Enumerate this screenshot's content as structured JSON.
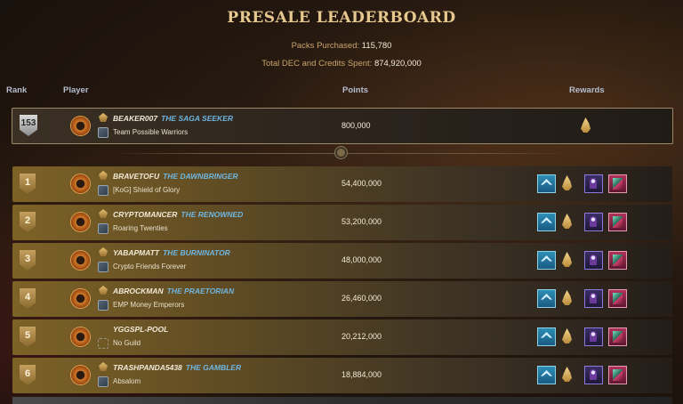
{
  "title": "PRESALE LEADERBOARD",
  "stats": {
    "packs_label": "Packs Purchased:",
    "packs_value": "115,780",
    "spent_label": "Total DEC and Credits Spent:",
    "spent_value": "874,920,000"
  },
  "headers": {
    "rank": "Rank",
    "player": "Player",
    "points": "Points",
    "rewards": "Rewards"
  },
  "current_player": {
    "rank": "153",
    "name": "BEAKER007",
    "title": "THE SAGA SEEKER",
    "guild": "Team Possible Warriors",
    "points": "800,000"
  },
  "rows": [
    {
      "rank": "1",
      "name": "BRAVETOFU",
      "title": "THE DAWNBRINGER",
      "guild": "[KoG] Shield of Glory",
      "points": "54,400,000"
    },
    {
      "rank": "2",
      "name": "CRYPTOMANCER",
      "title": "THE RENOWNED",
      "guild": "Roaring Twenties",
      "points": "53,200,000"
    },
    {
      "rank": "3",
      "name": "YABAPMATT",
      "title": "THE BURNINATOR",
      "guild": "Crypto Friends Forever",
      "points": "48,000,000"
    },
    {
      "rank": "4",
      "name": "ABROCKMAN",
      "title": "THE PRAETORIAN",
      "guild": "EMP Money Emperors",
      "points": "26,460,000"
    },
    {
      "rank": "5",
      "name": "YGGSPL-POOL",
      "title": "",
      "guild": "No Guild",
      "points": "20,212,000"
    },
    {
      "rank": "6",
      "name": "TRASHPANDA5438",
      "title": "THE GAMBLER",
      "guild": "Absalom",
      "points": "18,884,000"
    }
  ],
  "reward_icons": [
    "upgrade-chevron-icon",
    "gold-flame-icon",
    "purple-card-icon",
    "red-card-icon"
  ]
}
